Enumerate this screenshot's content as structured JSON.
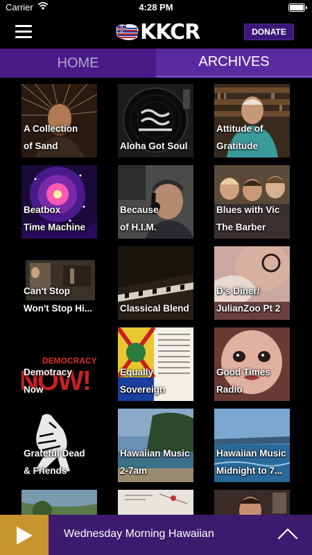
{
  "status_bar": {
    "carrier": "Carrier",
    "time": "4:28 PM",
    "battery_level": 1.0
  },
  "header": {
    "logo_text": "KKCR",
    "donate_label": "DONATE"
  },
  "tabs": [
    {
      "label": "HOME",
      "selected": false
    },
    {
      "label": "ARCHIVES",
      "selected": true
    }
  ],
  "archives": [
    {
      "line1": "A Collection",
      "line2": "of Sand"
    },
    {
      "line1": "",
      "line2": "Aloha Got Soul"
    },
    {
      "line1": "Attitude of",
      "line2": "Gratitude"
    },
    {
      "line1": "Beatbox",
      "line2": "Time Machine"
    },
    {
      "line1": "Because",
      "line2": "of H.I.M."
    },
    {
      "line1": "Blues with Vic",
      "line2": "The Barber"
    },
    {
      "line1": "Can't Stop",
      "line2": "Won't Stop Hi..."
    },
    {
      "line1": "",
      "line2": "Classical Blend"
    },
    {
      "line1": "D's Diner/",
      "line2": "JulianZoo Pt 2"
    },
    {
      "line1": "Demotracy",
      "line2": "Now"
    },
    {
      "line1": "Equally",
      "line2": "Sovereign"
    },
    {
      "line1": "Good Times",
      "line2": "Radio"
    },
    {
      "line1": "Grateful Dead",
      "line2": "& Friends"
    },
    {
      "line1": "Hawaiian Music",
      "line2": "2-7am"
    },
    {
      "line1": "Hawaiian Music",
      "line2": "Midnight to 7..."
    },
    {
      "line1": "",
      "line2": ""
    },
    {
      "line1": "",
      "line2": ""
    },
    {
      "line1": "",
      "line2": ""
    }
  ],
  "poster_text": {
    "democracy": "DEMOCRACY",
    "now": "NOW!"
  },
  "player": {
    "now_playing": "Wednesday Morning Hawaiian"
  },
  "colors": {
    "brand_purple": "#4a1b87",
    "play_gold": "#c7952e",
    "player_bg": "#3d1a6e"
  }
}
